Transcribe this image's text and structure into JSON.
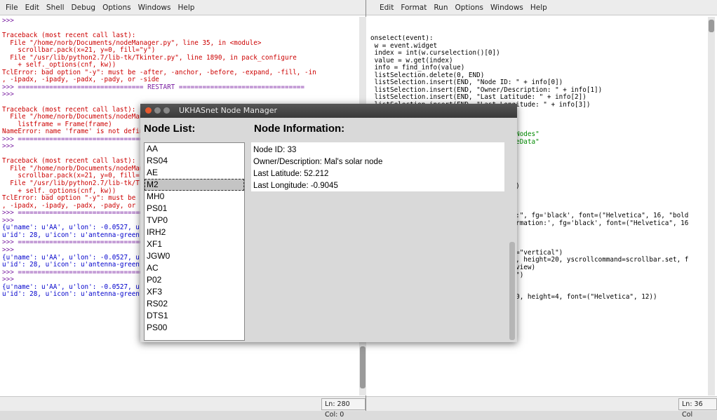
{
  "shell": {
    "menu": [
      "File",
      "Edit",
      "Shell",
      "Debug",
      "Options",
      "Windows",
      "Help"
    ],
    "lines": [
      {
        "t": ">>>",
        "c": "purple"
      },
      {
        "t": "",
        "c": ""
      },
      {
        "t": "Traceback (most recent call last):",
        "c": "red"
      },
      {
        "t": "  File \"/home/norb/Documents/nodeManager.py\", line 35, in <module>",
        "c": "red"
      },
      {
        "t": "    scrollbar.pack(x=21, y=0, fill=\"y\")",
        "c": "red"
      },
      {
        "t": "  File \"/usr/lib/python2.7/lib-tk/Tkinter.py\", line 1890, in pack_configure",
        "c": "red"
      },
      {
        "t": "    + self._options(cnf, kw))",
        "c": "red"
      },
      {
        "t": "TclError: bad option \"-y\": must be -after, -anchor, -before, -expand, -fill, -in",
        "c": "red"
      },
      {
        "t": ", -ipadx, -ipady, -padx, -pady, or -side",
        "c": "red"
      },
      {
        "t": ">>> ================================ RESTART ================================",
        "c": "purple"
      },
      {
        "t": ">>>",
        "c": "purple"
      },
      {
        "t": "",
        "c": ""
      },
      {
        "t": "Traceback (most recent call last):",
        "c": "red"
      },
      {
        "t": "  File \"/home/norb/Documents/nodeManager.py\"",
        "c": "red"
      },
      {
        "t": "    listframe = Frame(frame)",
        "c": "red"
      },
      {
        "t": "NameError: name 'frame' is not defined",
        "c": "red"
      },
      {
        "t": ">>> ================================ RESTART ================================",
        "c": "purple"
      },
      {
        "t": ">>>",
        "c": "purple"
      },
      {
        "t": "",
        "c": ""
      },
      {
        "t": "Traceback (most recent call last):",
        "c": "red"
      },
      {
        "t": "  File \"/home/norb/Documents/nodeManager.py\"",
        "c": "red"
      },
      {
        "t": "    scrollbar.pack(x=21, y=0, fill=\"y\")",
        "c": "red"
      },
      {
        "t": "  File \"/usr/lib/python2.7/lib-tk/Tkinter.py\"",
        "c": "red"
      },
      {
        "t": "    + self._options(cnf, kw))",
        "c": "red"
      },
      {
        "t": "TclError: bad option \"-y\": must be -after",
        "c": "red"
      },
      {
        "t": ", -ipadx, -ipady, -padx, -pady, or -side",
        "c": "red"
      },
      {
        "t": ">>> ================================ RESTART ================================",
        "c": "purple"
      },
      {
        "t": ">>>",
        "c": "purple"
      },
      {
        "t": "{u'name': u'AA', u'lon': -0.0527, u'lat': 51.498, u'owner': None, u'alt': None,",
        "c": "blue"
      },
      {
        "t": "u'id': 28, u'icon': u'antenna-green'}",
        "c": "blue"
      },
      {
        "t": ">>> ================================ RESTART ================================",
        "c": "purple"
      },
      {
        "t": ">>>",
        "c": "purple"
      },
      {
        "t": "{u'name': u'AA', u'lon': -0.0527, u'lat': 51.498, u'owner': None, u'alt': None,",
        "c": "blue"
      },
      {
        "t": "u'id': 28, u'icon': u'antenna-green'}",
        "c": "blue"
      },
      {
        "t": ">>> ================================ RESTART ================================",
        "c": "purple"
      },
      {
        "t": ">>>",
        "c": "purple"
      },
      {
        "t": "{u'name': u'AA', u'lon': -0.0527, u'lat': 51.498, u'owner': None, u'alt': None,",
        "c": "blue"
      },
      {
        "t": "u'id': 28, u'icon': u'antenna-green'}",
        "c": "blue"
      }
    ],
    "status": "Ln: 280 Col: 0"
  },
  "editor": {
    "menu": [
      "Edit",
      "Format",
      "Run",
      "Options",
      "Windows",
      "Help"
    ],
    "lines": [
      {
        "t": "onselect(event):",
        "c": ""
      },
      {
        "t": " w = event.widget",
        "c": ""
      },
      {
        "t": " index = int(w.curselection()[0])",
        "c": ""
      },
      {
        "t": " value = w.get(index)",
        "c": ""
      },
      {
        "t": " info = find_info(value)",
        "c": ""
      },
      {
        "t": " listSelection.delete(0, END)",
        "c": ""
      },
      {
        "t": " listSelection.insert(END, \"Node ID: \" + info[0])",
        "c": ""
      },
      {
        "t": " listSelection.insert(END, \"Owner/Description: \" + info[1])",
        "c": ""
      },
      {
        "t": " listSelection.insert(END, \"Last Latitude: \" + info[2])",
        "c": ""
      },
      {
        "t": " listSelection.insert(END, \"Last Longitude: \" + info[3])",
        "c": ""
      },
      {
        "t": "",
        "c": ""
      },
      {
        "t": "",
        "c": ""
      },
      {
        "t": "",
        "c": ""
      },
      {
        "t": "                                    pNodes\"",
        "c": "green"
      },
      {
        "t": "                                    deData\"",
        "c": "green"
      },
      {
        "t": "",
        "c": ""
      },
      {
        "t": "",
        "c": ""
      },
      {
        "t": "",
        "c": ""
      },
      {
        "t": "",
        "c": ""
      },
      {
        "t": "",
        "c": ""
      },
      {
        "t": "                                    \")",
        "c": ""
      },
      {
        "t": "",
        "c": ""
      },
      {
        "t": "",
        "c": ""
      },
      {
        "t": "",
        "c": ""
      },
      {
        "t": "                                    t:\", fg='black', font=(\"Helvetica\", 16, \"bold",
        "c": ""
      },
      {
        "t": "                                    ormation:', fg='black', font=(\"Helvetica\", 16",
        "c": ""
      },
      {
        "t": "",
        "c": ""
      },
      {
        "t": "",
        "c": ""
      },
      {
        "t": "",
        "c": ""
      },
      {
        "t": "                                    t=\"vertical\")",
        "c": ""
      },
      {
        "t": "                                    0, height=20, yscrollcommand=scrollbar.set, f",
        "c": ""
      },
      {
        "t": "                                    yview)",
        "c": ""
      },
      {
        "t": "                                    y\")",
        "c": ""
      },
      {
        "t": "",
        "c": ""
      },
      {
        "t": "",
        "c": ""
      },
      {
        "t": "stSelection = Listbox(window, width=50, height=4, font=(\"Helvetica\", 12))",
        "c": ""
      },
      {
        "t": "",
        "c": ""
      },
      {
        "t": "",
        "c": ""
      },
      {
        "t": "pack objects onto window",
        "c": "orange"
      },
      {
        "t": "stNodes.place(x=1, y=40)",
        "c": ""
      },
      {
        "t": "stSelection.place(x=200, y=40)",
        "c": ""
      }
    ],
    "status": "Ln: 36 Col"
  },
  "dialog": {
    "title": "UKHASnet Node Manager",
    "node_list_heading": "Node List:",
    "node_info_heading": "Node Information:",
    "nodes": [
      "AA",
      "RS04",
      "AE",
      "M2",
      "MH0",
      "PS01",
      "TVP0",
      "IRH2",
      "XF1",
      "JGW0",
      "AC",
      "P02",
      "XF3",
      "RS02",
      "DTS1",
      "PS00"
    ],
    "selected_node": "M2",
    "info": [
      "Node ID: 33",
      "Owner/Description: Mal's solar node",
      "Last Latitude: 52.212",
      "Last Longitude: -0.9045"
    ]
  },
  "colors": {
    "close": "#e8592e",
    "minimize": "#8a8a8a",
    "maximize": "#8a8a8a"
  }
}
